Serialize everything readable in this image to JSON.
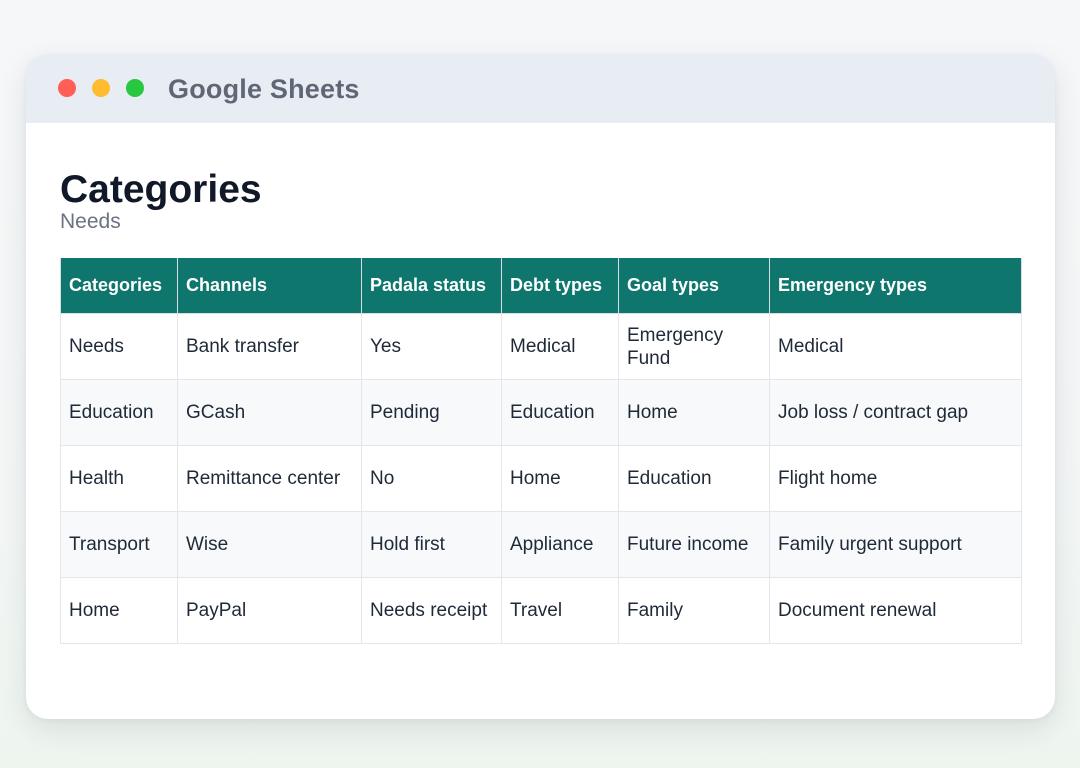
{
  "window": {
    "title": "Google Sheets"
  },
  "page": {
    "title": "Categories",
    "subtitle": "Needs"
  },
  "table": {
    "headers": [
      "Categories",
      "Channels",
      "Padala status",
      "Debt types",
      "Goal types",
      "Emergency types"
    ],
    "rows": [
      [
        "Needs",
        "Bank transfer",
        "Yes",
        "Medical",
        "Emergency Fund",
        "Medical"
      ],
      [
        "Education",
        "GCash",
        "Pending",
        "Education",
        "Home",
        "Job loss / contract gap"
      ],
      [
        "Health",
        "Remittance center",
        "No",
        "Home",
        "Education",
        "Flight home"
      ],
      [
        "Transport",
        "Wise",
        "Hold first",
        "Appliance",
        "Future income",
        "Family urgent support"
      ],
      [
        "Home",
        "PayPal",
        "Needs receipt",
        "Travel",
        "Family",
        "Document renewal"
      ]
    ]
  },
  "colors": {
    "header_bg": "#0f766e",
    "titlebar_bg": "#e8ecf3",
    "close": "#ff5f57",
    "minimize": "#febc2e",
    "maximize": "#28c840"
  }
}
